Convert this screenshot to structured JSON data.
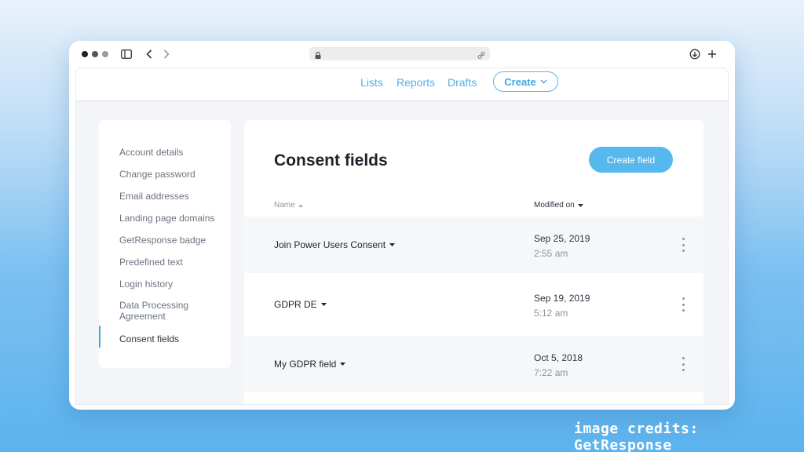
{
  "topnav": {
    "links": [
      "Lists",
      "Reports",
      "Drafts"
    ],
    "create_label": "Create"
  },
  "sidebar": {
    "items": [
      "Account details",
      "Change password",
      "Email addresses",
      "Landing page domains",
      "GetResponse badge",
      "Predefined text",
      "Login history",
      "Data Processing Agreement",
      "Consent fields"
    ],
    "active": "Consent fields"
  },
  "main": {
    "title": "Consent fields",
    "create_button": "Create field",
    "columns": {
      "name": "Name",
      "modified": "Modified on"
    },
    "rows": [
      {
        "name": "Join Power Users Consent",
        "date": "Sep 25, 2019",
        "time": "2:55 am"
      },
      {
        "name": "GDPR DE",
        "date": "Sep 19, 2019",
        "time": "5:12 am"
      },
      {
        "name": "My GDPR field",
        "date": "Oct 5, 2018",
        "time": "7:22 am"
      }
    ]
  },
  "credits": "image credits: GetResponse",
  "colors": {
    "accent": "#56b8ec",
    "background": "#f3f5f8"
  }
}
